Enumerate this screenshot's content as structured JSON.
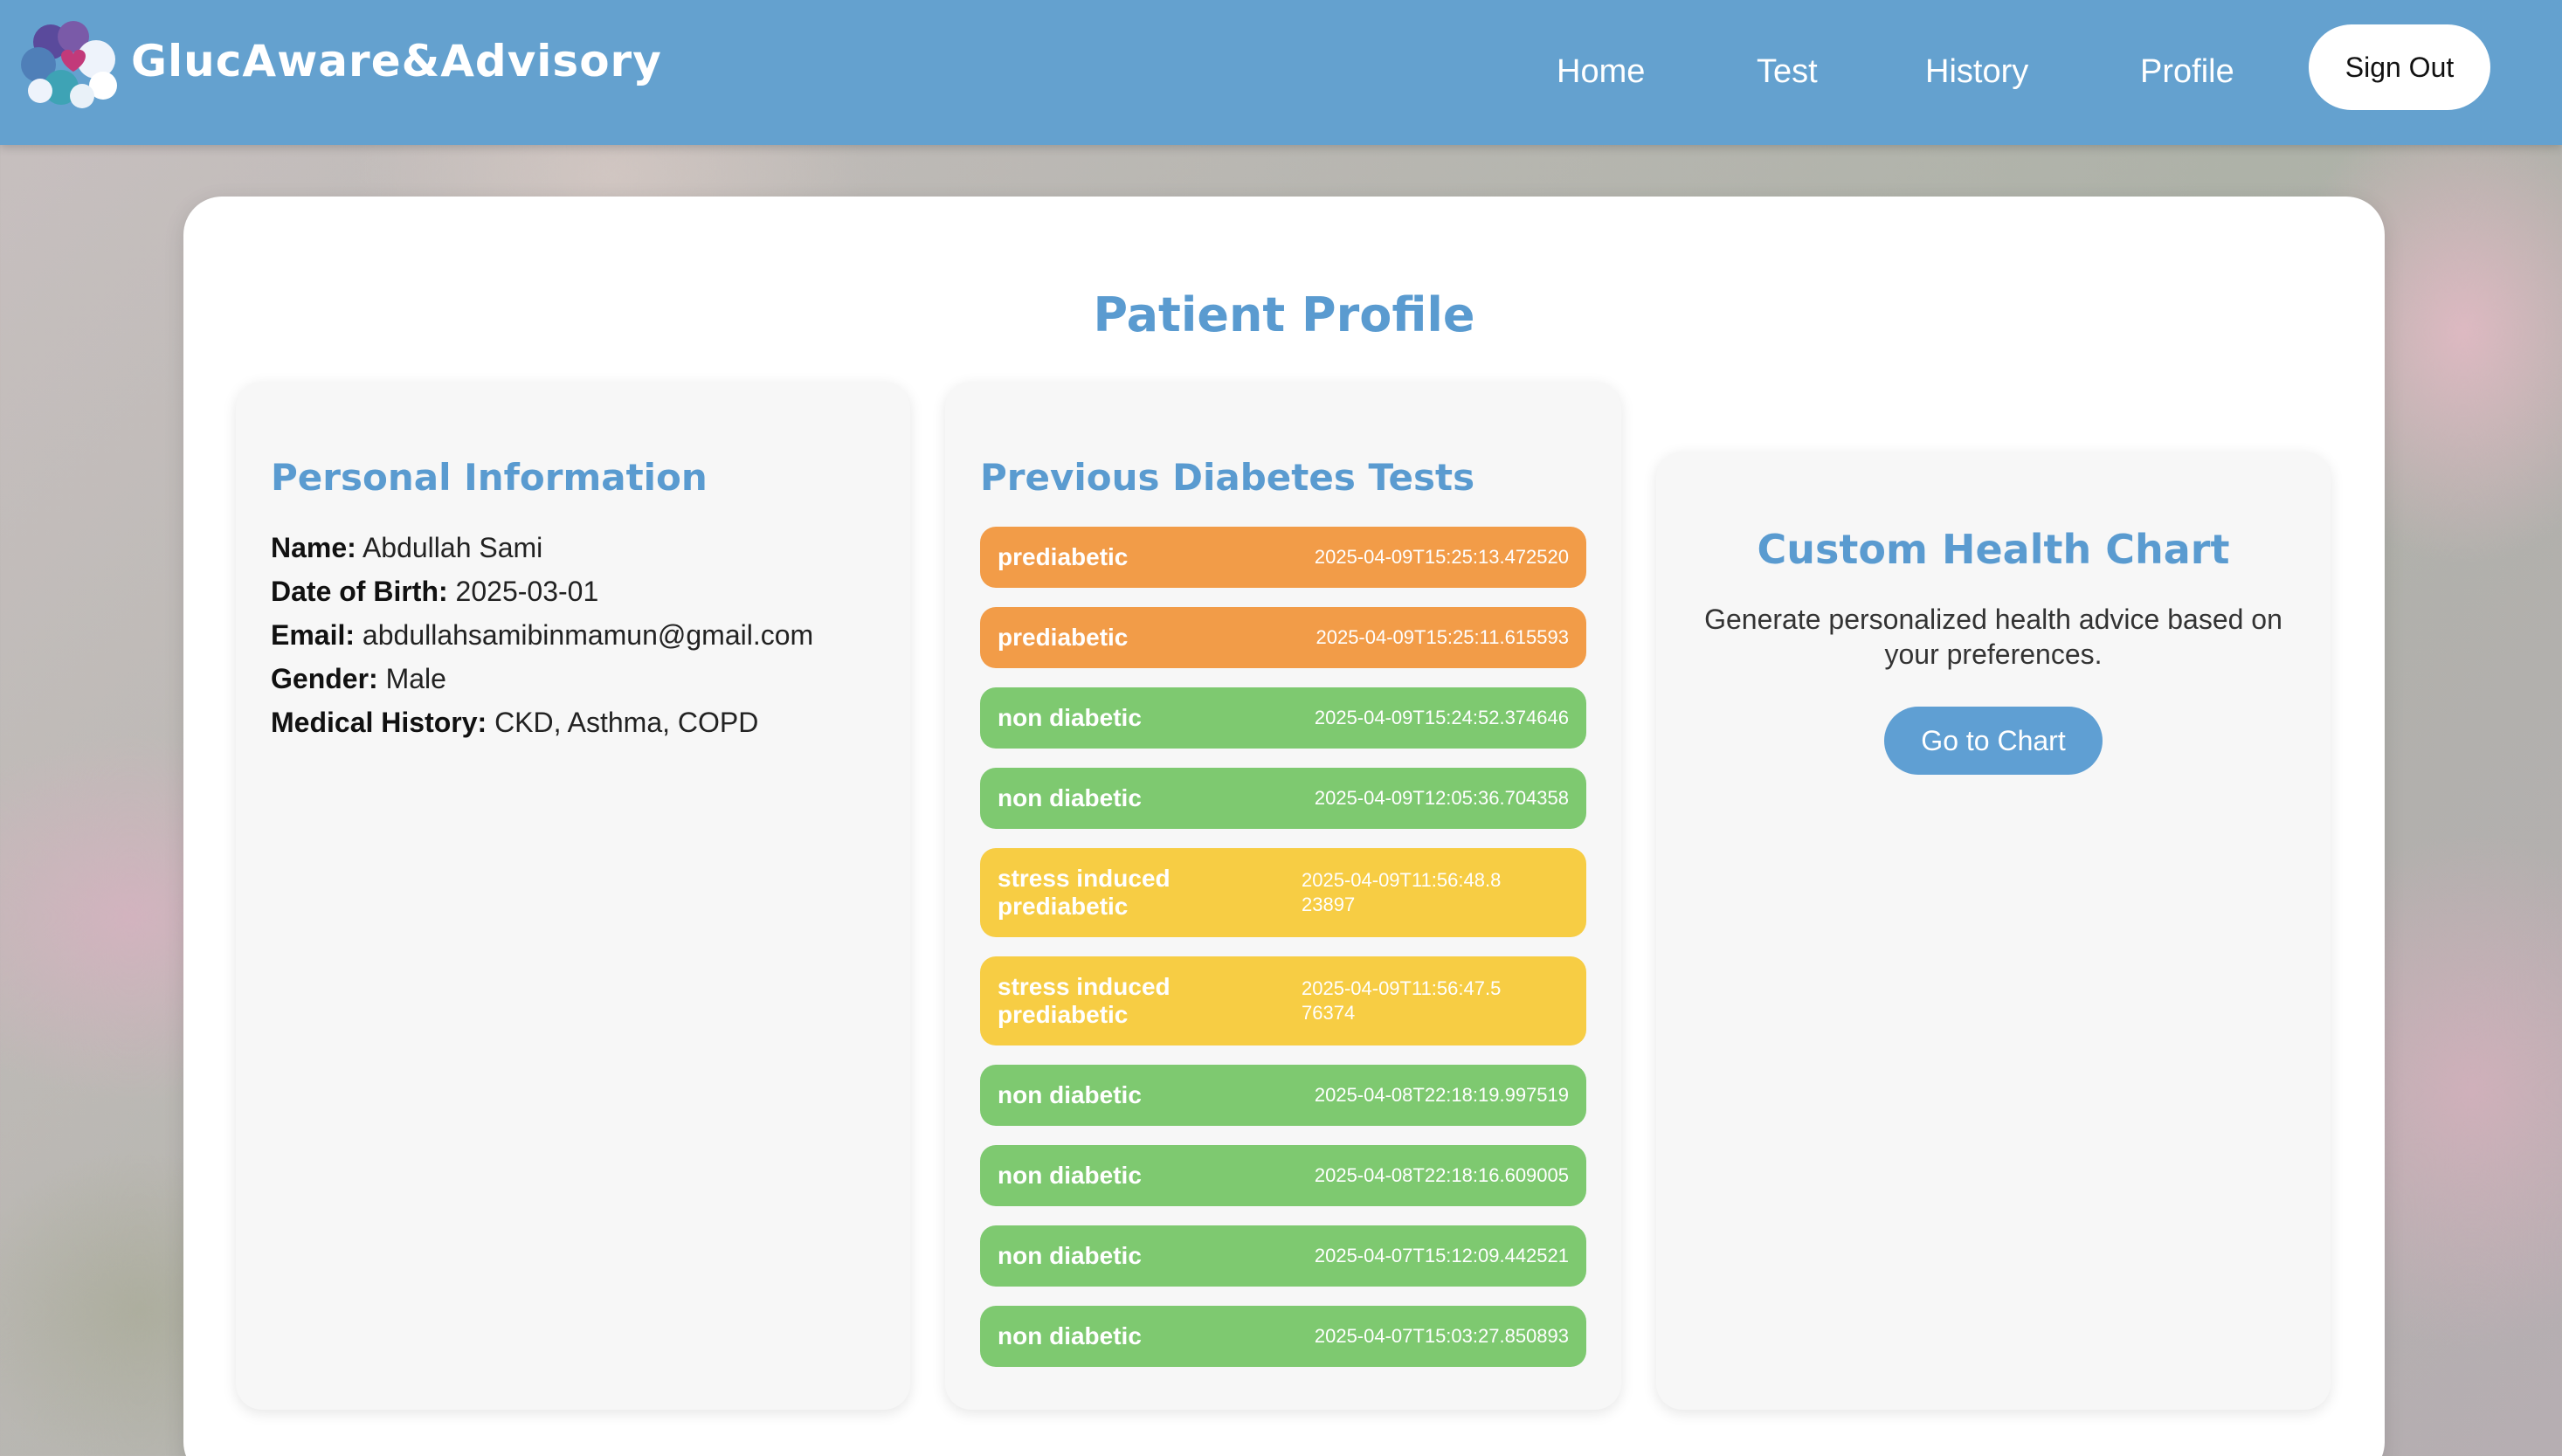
{
  "header": {
    "brand": "GlucAware&Advisory",
    "nav": [
      "Home",
      "Test",
      "History",
      "Profile"
    ],
    "sign_out": "Sign Out"
  },
  "page": {
    "title": "Patient Profile"
  },
  "personal_info": {
    "heading": "Personal Information",
    "fields": [
      {
        "label": "Name:",
        "value": "Abdullah Sami"
      },
      {
        "label": "Date of Birth:",
        "value": "2025-03-01"
      },
      {
        "label": "Email:",
        "value": "abdullahsamibinmamun@gmail.com"
      },
      {
        "label": "Gender:",
        "value": "Male"
      },
      {
        "label": "Medical History:",
        "value": "CKD, Asthma, COPD"
      }
    ]
  },
  "tests": {
    "heading": "Previous Diabetes Tests",
    "status_colors": {
      "prediabetic": "#f29c48",
      "non diabetic": "#7ec970",
      "stress induced prediabetic": "#f7cd44"
    },
    "items": [
      {
        "status": "prediabetic",
        "date": "2025-04-09T15:25:13.472520"
      },
      {
        "status": "prediabetic",
        "date": "2025-04-09T15:25:11.615593"
      },
      {
        "status": "non diabetic",
        "date": "2025-04-09T15:24:52.374646"
      },
      {
        "status": "non diabetic",
        "date": "2025-04-09T12:05:36.704358"
      },
      {
        "status": "stress induced prediabetic",
        "date": "2025-04-09T11:56:48.823897"
      },
      {
        "status": "stress induced prediabetic",
        "date": "2025-04-09T11:56:47.576374"
      },
      {
        "status": "non diabetic",
        "date": "2025-04-08T22:18:19.997519"
      },
      {
        "status": "non diabetic",
        "date": "2025-04-08T22:18:16.609005"
      },
      {
        "status": "non diabetic",
        "date": "2025-04-07T15:12:09.442521"
      },
      {
        "status": "non diabetic",
        "date": "2025-04-07T15:03:27.850893"
      }
    ]
  },
  "health_chart": {
    "heading": "Custom Health Chart",
    "description": "Generate personalized health advice based on your preferences.",
    "button": "Go to Chart"
  },
  "colors": {
    "navbar": "#64a1cf",
    "accent": "#5a9bd0"
  },
  "icons": {
    "logo": "heart-puzzle-logo-icon"
  }
}
